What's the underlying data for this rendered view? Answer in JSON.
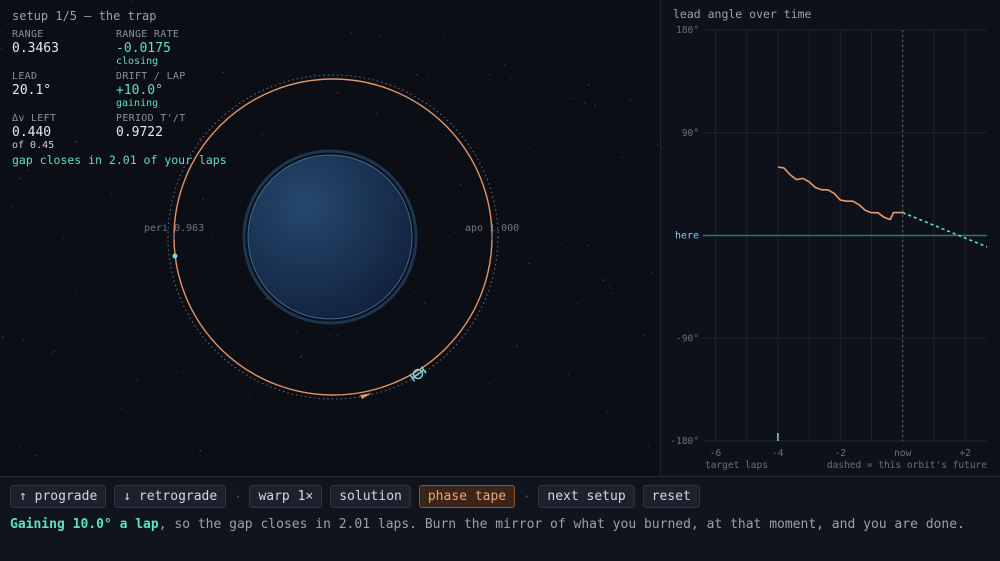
{
  "setup": {
    "title": "setup 1/5 — the trap"
  },
  "hud": {
    "range": {
      "label": "RANGE",
      "value": "0.3463"
    },
    "range_rate": {
      "label": "RANGE RATE",
      "value": "-0.0175",
      "note": "closing"
    },
    "lead": {
      "label": "LEAD",
      "value": "20.1°"
    },
    "drift": {
      "label": "DRIFT / LAP",
      "value": "+10.0°",
      "note": "gaining"
    },
    "dv": {
      "label": "Δv LEFT",
      "value": "0.440",
      "note": "of 0.45"
    },
    "period": {
      "label": "PERIOD T'/T",
      "value": "0.9722"
    },
    "gap_message": "gap closes in 2.01 of your laps"
  },
  "orbit": {
    "peri_label": "peri 0.963",
    "apo_label": "apo 1.000",
    "colors": {
      "orbit": "#e0956a",
      "planet": "#1d3a5c",
      "ship": "#7fd3e6",
      "target": "#f0a576"
    }
  },
  "chart": {
    "title": "lead angle over time",
    "here_label": "here",
    "ytick_labels": [
      "180°",
      "90°",
      "-90°",
      "-180°"
    ],
    "xtick_labels": [
      "-6",
      "-4",
      "-2",
      "now",
      "+2"
    ],
    "xlabel": "target laps",
    "note": "dashed = this orbit's future"
  },
  "chart_data": {
    "type": "line",
    "title": "lead angle over time",
    "xlabel": "target laps",
    "ylabel": "",
    "xlim": [
      -6.4,
      2.7
    ],
    "ylim": [
      -180,
      180
    ],
    "yticks": [
      180,
      90,
      -90,
      -180
    ],
    "xticks": [
      -6,
      -4,
      -2,
      0,
      2
    ],
    "reference_line": {
      "label": "here",
      "y": 0
    },
    "series": [
      {
        "style": "solid",
        "color": "#e89a6a",
        "points": [
          [
            -4.0,
            60
          ],
          [
            -3.8,
            59
          ],
          [
            -3.6,
            53
          ],
          [
            -3.4,
            49
          ],
          [
            -3.2,
            50
          ],
          [
            -3.0,
            47
          ],
          [
            -2.8,
            42
          ],
          [
            -2.6,
            40
          ],
          [
            -2.4,
            40
          ],
          [
            -2.2,
            37
          ],
          [
            -2.0,
            31
          ],
          [
            -1.8,
            30
          ],
          [
            -1.6,
            30
          ],
          [
            -1.4,
            27
          ],
          [
            -1.2,
            22
          ],
          [
            -1.0,
            20
          ],
          [
            -0.8,
            20
          ],
          [
            -0.6,
            16
          ],
          [
            -0.4,
            14
          ],
          [
            -0.3,
            20.1
          ],
          [
            0.0,
            20.1
          ]
        ]
      },
      {
        "style": "dashed",
        "color": "#5fe0c4",
        "points": [
          [
            0.0,
            20.1
          ],
          [
            2.7,
            -10
          ]
        ]
      }
    ],
    "now_marker": 0,
    "start_marker": -4
  },
  "controls": {
    "prograde": "↑ prograde",
    "retrograde": "↓ retrograde",
    "warp": "warp 1×",
    "solution": "solution",
    "phase_tape": "phase tape",
    "next_setup": "next setup",
    "reset": "reset",
    "separator": "·"
  },
  "status": {
    "highlight": "Gaining 10.0° a lap",
    "rest": ", so the gap closes in 2.01 laps. Burn the mirror of what you burned, at that moment, and you are done."
  }
}
